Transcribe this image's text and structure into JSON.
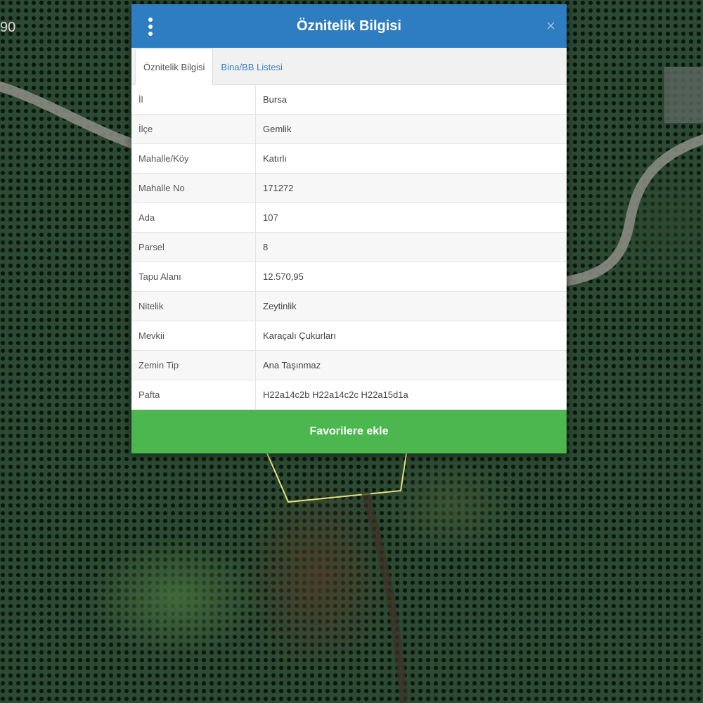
{
  "map": {
    "scale_text": "90"
  },
  "dialog": {
    "title": "Öznitelik Bilgisi",
    "close_glyph": "×",
    "tabs": [
      {
        "label": "Öznitelik Bilgisi",
        "active": true
      },
      {
        "label": "Bina/BB Listesi",
        "active": false
      }
    ],
    "rows": [
      {
        "key": "İl",
        "value": "Bursa"
      },
      {
        "key": "İlçe",
        "value": "Gemlik"
      },
      {
        "key": "Mahalle/Köy",
        "value": "Katırlı"
      },
      {
        "key": "Mahalle No",
        "value": "171272"
      },
      {
        "key": "Ada",
        "value": "107"
      },
      {
        "key": "Parsel",
        "value": "8"
      },
      {
        "key": "Tapu Alanı",
        "value": "12.570,95"
      },
      {
        "key": "Nitelik",
        "value": "Zeytinlik"
      },
      {
        "key": "Mevkii",
        "value": "Karaçalı Çukurları"
      },
      {
        "key": "Zemin Tip",
        "value": "Ana Taşınmaz"
      },
      {
        "key": "Pafta",
        "value": "H22a14c2b H22a14c2c H22a15d1a"
      }
    ],
    "favorite_button": "Favorilere ekle"
  },
  "colors": {
    "header": "#2f7dc1",
    "favorite_button": "#4cb64f",
    "parcel_outline": "#e8e07a",
    "road": "#9a9a90"
  },
  "icons": {
    "menu": "vertical-ellipsis-icon",
    "close": "close-icon"
  }
}
